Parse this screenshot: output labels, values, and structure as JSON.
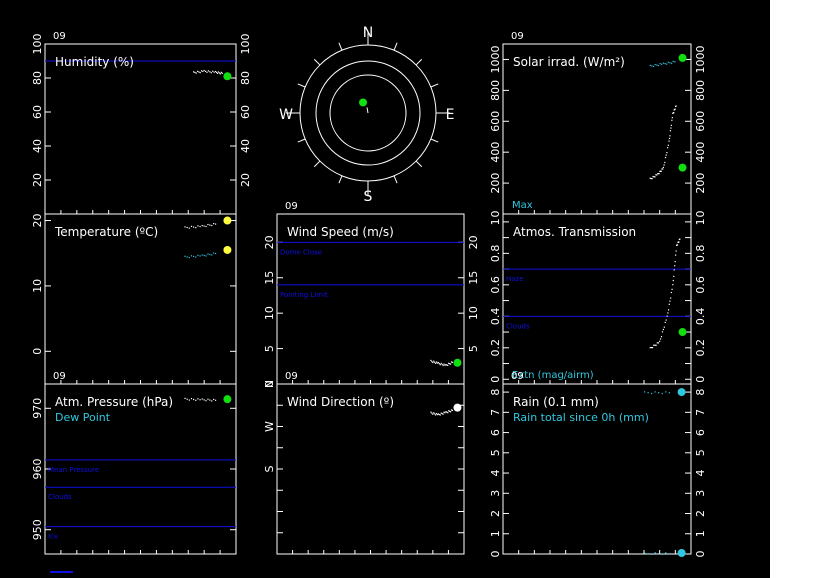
{
  "colors": {
    "background": "#000000",
    "frame": "#ffffff",
    "blue_line": "#1010e0",
    "cyan": "#30c8e0",
    "green": "#10e010",
    "yellow": "#ffff40"
  },
  "chart_data": [
    {
      "type": "scatter",
      "id": "humidity",
      "title": "Humidity (%)",
      "xlabel": "09",
      "ylim": [
        0,
        100
      ],
      "yticks": [
        0,
        20,
        40,
        60,
        80,
        100
      ],
      "ytick_labels_left": [
        "20",
        "40",
        "60",
        "80",
        "100"
      ],
      "ytick_labels_right": [
        "20",
        "40",
        "60",
        "80",
        "100"
      ],
      "hlines": [
        {
          "y": 90,
          "label": ""
        }
      ],
      "series": [
        {
          "color": "#ffffff",
          "trace": [
            [
              0.775,
              83.5
            ],
            [
              0.83,
              84.3
            ],
            [
              0.89,
              83.7
            ],
            [
              0.93,
              83
            ]
          ],
          "marker": [
            0.955,
            81
          ]
        }
      ]
    },
    {
      "type": "scatter",
      "id": "compass",
      "labels": {
        "n": "N",
        "e": "E",
        "s": "S",
        "w": "W"
      },
      "wind_point": {
        "direction_deg": 350,
        "radius_fraction": 0.15
      }
    },
    {
      "type": "scatter",
      "id": "solar",
      "title": "Solar irrad. (W/m²)",
      "xlabel": "09",
      "ylim": [
        0,
        1100
      ],
      "yticks": [
        0,
        200,
        400,
        600,
        800,
        1000
      ],
      "ytick_labels_left": [
        "0",
        "200",
        "400",
        "600",
        "800",
        "1000"
      ],
      "ytick_labels_right": [
        "0",
        "200",
        "400",
        "600",
        "800",
        "1000"
      ],
      "annotations": [
        "Max"
      ],
      "series": [
        {
          "color": "#30c8e0",
          "trace": [
            [
              0.78,
              960
            ],
            [
              0.85,
              975
            ],
            [
              0.92,
              990
            ]
          ],
          "marker": [
            0.955,
            1010
          ]
        },
        {
          "color": "#ffffff",
          "trace": [
            [
              0.78,
              230
            ],
            [
              0.82,
              260
            ],
            [
              0.85,
              300
            ],
            [
              0.88,
              470
            ],
            [
              0.9,
              650
            ],
            [
              0.92,
              710
            ]
          ],
          "marker": [
            0.955,
            300
          ]
        }
      ]
    },
    {
      "type": "scatter",
      "id": "temperature",
      "title": "Temperature (ºC)",
      "ylim": [
        -5,
        21
      ],
      "yticks": [
        0,
        10,
        20
      ],
      "ytick_labels_left": [
        "0",
        "10",
        "20"
      ],
      "series": [
        {
          "color": "#ffffff",
          "trace": [
            [
              0.73,
              19
            ],
            [
              0.82,
              19.2
            ],
            [
              0.9,
              19.6
            ]
          ],
          "marker": [
            0.955,
            20
          ]
        },
        {
          "color": "#30c8e0",
          "trace": [
            [
              0.73,
              14.5
            ],
            [
              0.82,
              14.7
            ],
            [
              0.9,
              15.1
            ]
          ],
          "marker": [
            0.955,
            15.5
          ]
        }
      ]
    },
    {
      "type": "scatter",
      "id": "windspeed",
      "title": "Wind Speed (m/s)",
      "xlabel": "09",
      "ylim": [
        0,
        24
      ],
      "yticks": [
        0,
        5,
        10,
        15,
        20
      ],
      "ytick_labels_left": [
        "0",
        "5",
        "10",
        "15",
        "20"
      ],
      "ytick_labels_right": [
        "5",
        "10",
        "15",
        "20"
      ],
      "hlines": [
        {
          "y": 20,
          "label": "Dome Close"
        },
        {
          "y": 14,
          "label": "Pointing Limit"
        }
      ],
      "series": [
        {
          "color": "#ffffff",
          "trace": [
            [
              0.82,
              3.3
            ],
            [
              0.86,
              3.0
            ],
            [
              0.9,
              2.7
            ],
            [
              0.94,
              3.2
            ]
          ],
          "marker": [
            0.965,
            3
          ]
        }
      ]
    },
    {
      "type": "scatter",
      "id": "transmission",
      "title": "Atmos. Transmission",
      "ylim": [
        -0.03,
        1.05
      ],
      "yticks": [
        0,
        0.1,
        0.2,
        0.3,
        0.4,
        0.5,
        0.6,
        0.7,
        0.8,
        0.9,
        1
      ],
      "ytick_labels_left": [
        "0",
        "0.2",
        "0.4",
        "0.6",
        "0.8",
        "1"
      ],
      "ytick_labels_right": [
        "0",
        "0.2",
        "0.4",
        "0.6",
        "0.8",
        "1"
      ],
      "annotations": [
        "Extn (mag/airm)"
      ],
      "hlines": [
        {
          "y": 0.7,
          "label": "Haze"
        },
        {
          "y": 0.4,
          "label": "Clouds"
        }
      ],
      "series": [
        {
          "color": "#ffffff",
          "trace": [
            [
              0.78,
              0.2
            ],
            [
              0.83,
              0.24
            ],
            [
              0.87,
              0.4
            ],
            [
              0.9,
              0.6
            ],
            [
              0.92,
              0.85
            ],
            [
              0.94,
              0.9
            ]
          ],
          "marker": [
            0.955,
            0.3
          ]
        },
        {
          "color": "#30c8e0",
          "trace": [
            [
              0.93,
              1.0
            ]
          ],
          "marker": null
        }
      ]
    },
    {
      "type": "scatter",
      "id": "pressure",
      "title": "Atm. Pressure (hPa)",
      "subtitle": "Dew Point",
      "xlabel": "09",
      "ylim": [
        946,
        974
      ],
      "yticks": [
        950,
        960,
        970
      ],
      "ytick_labels_left": [
        "950",
        "960",
        "970"
      ],
      "hlines": [
        {
          "y": 961.5,
          "label": "Mean Pressure"
        },
        {
          "y": 957,
          "label": "Clouds"
        },
        {
          "y": 950.5,
          "label": "Ice"
        }
      ],
      "series": [
        {
          "color": "#ffffff",
          "trace": [
            [
              0.73,
              971.6
            ],
            [
              0.82,
              971.5
            ],
            [
              0.9,
              971.4
            ]
          ],
          "marker": [
            0.955,
            971.5
          ]
        }
      ]
    },
    {
      "type": "scatter",
      "id": "winddir",
      "title": "Wind Direction (º)",
      "xlabel": "09",
      "ylim": [
        0,
        360
      ],
      "yticks": [
        45,
        90,
        135,
        180,
        225,
        270,
        315
      ],
      "ytick_labels_left": [
        "S",
        "W",
        "N"
      ],
      "ytick_label_values": [
        180,
        270,
        360
      ],
      "series": [
        {
          "color": "#ffffff",
          "trace": [
            [
              0.82,
              300
            ],
            [
              0.86,
              296
            ],
            [
              0.9,
              301
            ],
            [
              0.94,
              306
            ]
          ],
          "marker": [
            0.965,
            310
          ]
        }
      ]
    },
    {
      "type": "scatter",
      "id": "rain",
      "title": "Rain (0.1 mm)",
      "subtitle": "Rain total since 0h (mm)",
      "xlabel": "09",
      "ylim": [
        0,
        8.4
      ],
      "yticks": [
        0,
        1,
        2,
        3,
        4,
        5,
        6,
        7,
        8
      ],
      "ytick_labels_left": [
        "0",
        "1",
        "2",
        "3",
        "4",
        "5",
        "6",
        "7",
        "8"
      ],
      "ytick_labels_right": [
        "0",
        "1",
        "2",
        "3",
        "4",
        "5",
        "6",
        "7",
        "8"
      ],
      "series": [
        {
          "color": "#30c8e0",
          "trace": [
            [
              0.75,
              8
            ],
            [
              0.9,
              8
            ]
          ],
          "marker": [
            0.95,
            8
          ]
        },
        {
          "color": "#30c8e0",
          "trace": [
            [
              0.75,
              0.05
            ],
            [
              0.9,
              0.05
            ]
          ],
          "marker": [
            0.95,
            0.05
          ]
        }
      ]
    }
  ]
}
